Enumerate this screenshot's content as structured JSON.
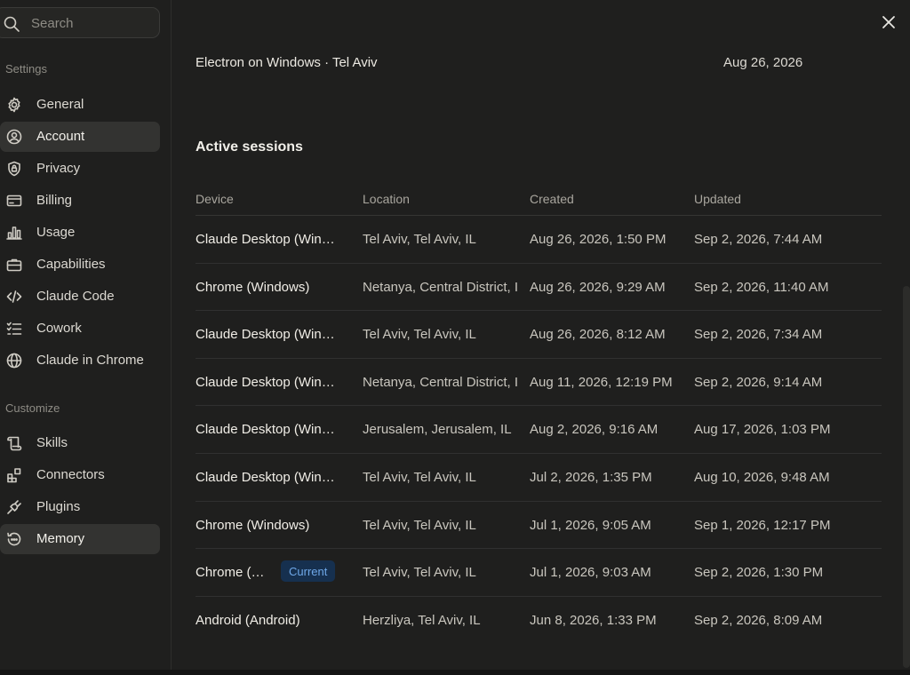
{
  "search": {
    "placeholder": "Search"
  },
  "sidebar": {
    "settings_label": "Settings",
    "settings_items": [
      {
        "label": "General",
        "icon": "gear-icon"
      },
      {
        "label": "Account",
        "icon": "user-circle-icon",
        "active": true
      },
      {
        "label": "Privacy",
        "icon": "shield-lock-icon"
      },
      {
        "label": "Billing",
        "icon": "credit-card-icon"
      },
      {
        "label": "Usage",
        "icon": "bar-chart-icon"
      },
      {
        "label": "Capabilities",
        "icon": "briefcase-icon"
      },
      {
        "label": "Claude Code",
        "icon": "code-icon"
      },
      {
        "label": "Cowork",
        "icon": "checklist-icon"
      },
      {
        "label": "Claude in Chrome",
        "icon": "globe-icon"
      }
    ],
    "customize_label": "Customize",
    "customize_items": [
      {
        "label": "Skills",
        "icon": "scroll-icon"
      },
      {
        "label": "Connectors",
        "icon": "connectors-icon"
      },
      {
        "label": "Plugins",
        "icon": "plug-icon"
      },
      {
        "label": "Memory",
        "icon": "memory-icon",
        "active": true
      }
    ]
  },
  "previous_row": {
    "device": "Electron on Windows · Tel Aviv",
    "date": "Aug 26, 2026"
  },
  "sessions": {
    "title": "Active sessions",
    "columns": [
      "Device",
      "Location",
      "Created",
      "Updated"
    ],
    "rows": [
      {
        "device": "Claude Desktop (Windows)",
        "location": "Tel Aviv, Tel Aviv, IL",
        "created": "Aug 26, 2026, 1:50 PM",
        "updated": "Sep 2, 2026, 7:44 AM"
      },
      {
        "device": "Chrome (Windows)",
        "location": "Netanya, Central District, IL",
        "created": "Aug 26, 2026, 9:29 AM",
        "updated": "Sep 2, 2026, 11:40 AM"
      },
      {
        "device": "Claude Desktop (Windows)",
        "location": "Tel Aviv, Tel Aviv, IL",
        "created": "Aug 26, 2026, 8:12 AM",
        "updated": "Sep 2, 2026, 7:34 AM"
      },
      {
        "device": "Claude Desktop (Windows)",
        "location": "Netanya, Central District, IL",
        "created": "Aug 11, 2026, 12:19 PM",
        "updated": "Sep 2, 2026, 9:14 AM"
      },
      {
        "device": "Claude Desktop (Windows)",
        "location": "Jerusalem, Jerusalem, IL",
        "created": "Aug 2, 2026, 9:16 AM",
        "updated": "Aug 17, 2026, 1:03 PM"
      },
      {
        "device": "Claude Desktop (Windows)",
        "location": "Tel Aviv, Tel Aviv, IL",
        "created": "Jul 2, 2026, 1:35 PM",
        "updated": "Aug 10, 2026, 9:48 AM"
      },
      {
        "device": "Chrome (Windows)",
        "location": "Tel Aviv, Tel Aviv, IL",
        "created": "Jul 1, 2026, 9:05 AM",
        "updated": "Sep 1, 2026, 12:17 PM"
      },
      {
        "device": "Chrome (Windows)",
        "location": "Tel Aviv, Tel Aviv, IL",
        "created": "Jul 1, 2026, 9:03 AM",
        "updated": "Sep 2, 2026, 1:30 PM",
        "badge": "Current"
      },
      {
        "device": "Android (Android)",
        "location": "Herzliya, Tel Aviv, IL",
        "created": "Jun 8, 2026, 1:33 PM",
        "updated": "Sep 2, 2026, 8:09 AM"
      }
    ]
  },
  "colors": {
    "background": "#1f1f1e",
    "active_item": "#333331",
    "badge_bg": "#16304f",
    "badge_text": "#6fa8e8"
  }
}
